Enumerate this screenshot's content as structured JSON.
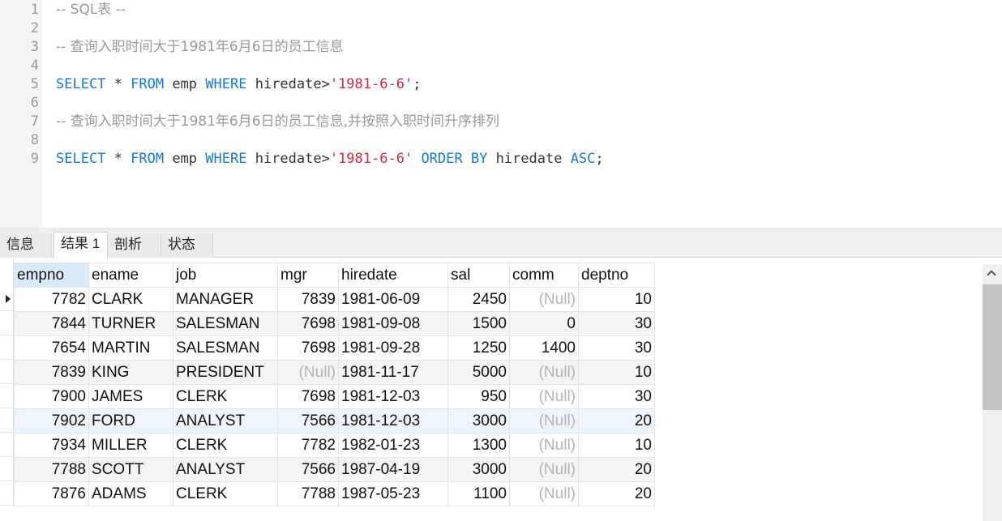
{
  "editor": {
    "lines": [
      {
        "n": "1",
        "segments": [
          {
            "t": "-- SQL表 --",
            "c": "comment"
          }
        ]
      },
      {
        "n": "2",
        "segments": []
      },
      {
        "n": "3",
        "segments": [
          {
            "t": "-- 查询入职时间大于1981年6月6日的员工信息",
            "c": "comment"
          }
        ]
      },
      {
        "n": "4",
        "segments": []
      },
      {
        "n": "5",
        "segments": [
          {
            "t": "SELECT",
            "c": "kw"
          },
          {
            "t": " * ",
            "c": "plain"
          },
          {
            "t": "FROM",
            "c": "kw"
          },
          {
            "t": " emp ",
            "c": "plain"
          },
          {
            "t": "WHERE",
            "c": "kw"
          },
          {
            "t": " hiredate>",
            "c": "plain"
          },
          {
            "t": "'1981-6-6'",
            "c": "str"
          },
          {
            "t": ";",
            "c": "plain"
          }
        ]
      },
      {
        "n": "6",
        "segments": []
      },
      {
        "n": "7",
        "segments": [
          {
            "t": "-- 查询入职时间大于1981年6月6日的员工信息,并按照入职时间升序排列",
            "c": "comment"
          }
        ]
      },
      {
        "n": "8",
        "segments": []
      },
      {
        "n": "9",
        "segments": [
          {
            "t": "SELECT",
            "c": "kw"
          },
          {
            "t": " * ",
            "c": "plain"
          },
          {
            "t": "FROM",
            "c": "kw"
          },
          {
            "t": " emp ",
            "c": "plain"
          },
          {
            "t": "WHERE",
            "c": "kw"
          },
          {
            "t": " hiredate>",
            "c": "plain"
          },
          {
            "t": "'1981-6-6'",
            "c": "str"
          },
          {
            "t": " ",
            "c": "plain"
          },
          {
            "t": "ORDER BY",
            "c": "kw"
          },
          {
            "t": " hiredate ",
            "c": "plain"
          },
          {
            "t": "ASC",
            "c": "kw"
          },
          {
            "t": ";",
            "c": "plain"
          }
        ]
      }
    ]
  },
  "tabs": [
    {
      "label": "信息",
      "name": "tab-info"
    },
    {
      "label": "结果 1",
      "name": "tab-result-1",
      "active": true
    },
    {
      "label": "剖析",
      "name": "tab-profile"
    },
    {
      "label": "状态",
      "name": "tab-status"
    }
  ],
  "grid": {
    "columns": [
      {
        "label": "empno",
        "align": "num",
        "selected": true
      },
      {
        "label": "ename",
        "align": "txt"
      },
      {
        "label": "job",
        "align": "txt"
      },
      {
        "label": "mgr",
        "align": "num"
      },
      {
        "label": "hiredate",
        "align": "txt"
      },
      {
        "label": "sal",
        "align": "num"
      },
      {
        "label": "comm",
        "align": "num"
      },
      {
        "label": "deptno",
        "align": "num"
      }
    ],
    "null_text": "(Null)",
    "current_row": 0,
    "highlight_row": 5,
    "rows": [
      [
        "7782",
        "CLARK",
        "MANAGER",
        "7839",
        "1981-06-09",
        "2450",
        null,
        "10"
      ],
      [
        "7844",
        "TURNER",
        "SALESMAN",
        "7698",
        "1981-09-08",
        "1500",
        "0",
        "30"
      ],
      [
        "7654",
        "MARTIN",
        "SALESMAN",
        "7698",
        "1981-09-28",
        "1250",
        "1400",
        "30"
      ],
      [
        "7839",
        "KING",
        "PRESIDENT",
        null,
        "1981-11-17",
        "5000",
        null,
        "10"
      ],
      [
        "7900",
        "JAMES",
        "CLERK",
        "7698",
        "1981-12-03",
        "950",
        null,
        "30"
      ],
      [
        "7902",
        "FORD",
        "ANALYST",
        "7566",
        "1981-12-03",
        "3000",
        null,
        "20"
      ],
      [
        "7934",
        "MILLER",
        "CLERK",
        "7782",
        "1982-01-23",
        "1300",
        null,
        "10"
      ],
      [
        "7788",
        "SCOTT",
        "ANALYST",
        "7566",
        "1987-04-19",
        "3000",
        null,
        "20"
      ],
      [
        "7876",
        "ADAMS",
        "CLERK",
        "7788",
        "1987-05-23",
        "1100",
        null,
        "20"
      ]
    ]
  },
  "scrollbar": {
    "thumb_fraction": 0.53,
    "position_fraction": 0.0
  }
}
